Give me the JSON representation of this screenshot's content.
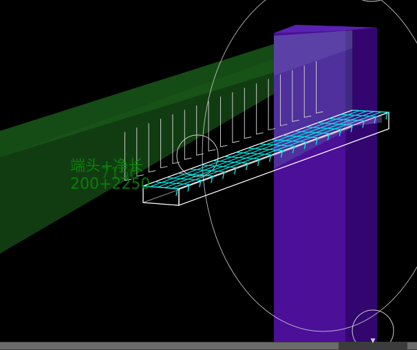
{
  "viewport": {
    "background": "#000000"
  },
  "colors": {
    "beam": "#1f7a1f",
    "column": "#5a1fb0",
    "slab_outline": "#ffffff",
    "rebar_cyan": "#00e5e5",
    "rebar_top": "#d8d8d8",
    "annotation": "#0a8a0a",
    "orbit_circle": "#d0d0d0"
  },
  "annotation": {
    "line1": "端头+净长",
    "line2": "200+2250",
    "overlap_value": "7150"
  },
  "scrollbar": {
    "arrow_icon": "chevron-down-icon"
  }
}
